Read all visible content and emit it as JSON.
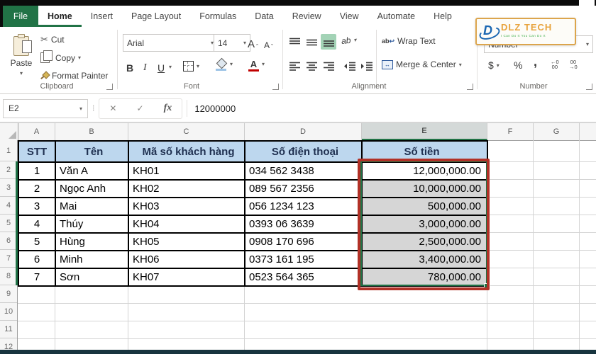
{
  "tab_bar": {
    "file_label": "File",
    "tabs": [
      {
        "label": "Home",
        "active": true
      },
      {
        "label": "Insert",
        "active": false
      },
      {
        "label": "Page Layout",
        "active": false
      },
      {
        "label": "Formulas",
        "active": false
      },
      {
        "label": "Data",
        "active": false
      },
      {
        "label": "Review",
        "active": false
      },
      {
        "label": "View",
        "active": false
      },
      {
        "label": "Automate",
        "active": false
      },
      {
        "label": "Help",
        "active": false
      }
    ]
  },
  "ribbon": {
    "clipboard": {
      "group_label": "Clipboard",
      "paste_label": "Paste",
      "cut_label": "Cut",
      "copy_label": "Copy",
      "format_painter_label": "Format Painter"
    },
    "font": {
      "group_label": "Font",
      "font_name": "Arial",
      "font_size": "14"
    },
    "alignment": {
      "group_label": "Alignment",
      "wrap_text_label": "Wrap Text",
      "merge_center_label": "Merge & Center"
    },
    "number": {
      "group_label": "Number",
      "format_value": "Number"
    }
  },
  "glyphs": {
    "chevron": "▾",
    "scissors": "✂",
    "bold": "B",
    "italic": "I",
    "underline": "U",
    "A": "A",
    "caret_up": "ˆ",
    "caret_down": "ˇ",
    "ab": "ab",
    "wrap_ab": "ab",
    "wrap_return": "↩",
    "merge_arrows": "↔",
    "dollar": "$",
    "percent": "%",
    "comma": ",",
    "inc_top": "←0",
    "inc_bottom": "00",
    "dec_top": "00",
    "dec_bottom": "→0",
    "cancel": "✕",
    "enter": "✓",
    "fx": "fx",
    "dots": "⁞"
  },
  "brand": {
    "d_letter": "D",
    "name": "DLZ TECH",
    "tagline": "I Can Do It You Can Do It"
  },
  "formula_bar": {
    "name_box": "E2",
    "value": "12000000"
  },
  "sheet": {
    "column_headers": [
      "A",
      "B",
      "C",
      "D",
      "E",
      "F",
      "G"
    ],
    "selected_column": "E",
    "row_headers": [
      "1",
      "2",
      "3",
      "4",
      "5",
      "6",
      "7",
      "8",
      "9",
      "10",
      "11",
      "12"
    ],
    "active_cell": "E2",
    "selected_range": "E2:E8",
    "table": {
      "headers": [
        "STT",
        "Tên",
        "Mã số khách hàng",
        "Số điện thoại",
        "Số tiền"
      ],
      "rows": [
        [
          "1",
          "Văn A",
          "KH01",
          "034 562 3438",
          "12,000,000.00"
        ],
        [
          "2",
          "Ngọc Anh",
          "KH02",
          "089 567 2356",
          "10,000,000.00"
        ],
        [
          "3",
          "Mai",
          "KH03",
          "056 1234 123",
          "500,000.00"
        ],
        [
          "4",
          "Thúy",
          "KH04",
          "0393 06 3639",
          "3,000,000.00"
        ],
        [
          "5",
          "Hùng",
          "KH05",
          "0908 170 696",
          "2,500,000.00"
        ],
        [
          "6",
          "Minh",
          "KH06",
          "0373 161 195",
          "3,400,000.00"
        ],
        [
          "7",
          "Sơn",
          "KH07",
          "0523 564 365",
          "780,000.00"
        ]
      ]
    }
  },
  "colors": {
    "excel_green": "#217346",
    "selection_green": "#1e7145",
    "annotation_red": "#b23127",
    "table_header_fill": "#bdd7ee",
    "selected_cell_fill": "#d6d6d6",
    "brand_orange": "#e8a33d",
    "brand_blue": "#1b67b2",
    "brand_green": "#3fae49"
  }
}
